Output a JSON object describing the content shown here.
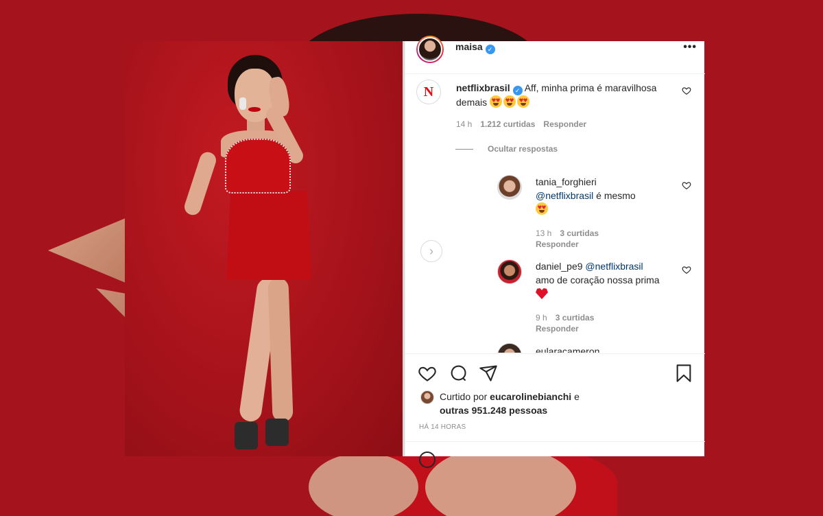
{
  "post": {
    "author": "maisa",
    "more_label": "•••"
  },
  "comments": [
    {
      "user": "netflixbrasil",
      "verified": true,
      "text": "Aff, minha prima é maravilhosa demais",
      "time": "14 h",
      "likes": "1.212 curtidas",
      "reply_label": "Responder"
    }
  ],
  "hide_replies": "Ocultar respostas",
  "replies": [
    {
      "user": "tania_forghieri",
      "mention": "@netflixbrasil",
      "text": "é mesmo",
      "time": "13 h",
      "likes": "3 curtidas",
      "reply_label": "Responder"
    },
    {
      "user": "daniel_pe9",
      "mention": "@netflixbrasil",
      "text": "amo de coração nossa prima",
      "time": "9 h",
      "likes": "3 curtidas",
      "reply_label": "Responder"
    },
    {
      "user": "eularacameron"
    }
  ],
  "likes_summary": {
    "prefix": "Curtido por",
    "user": "eucarolinebianchi",
    "connector": "e",
    "others": "outras 951.248 pessoas"
  },
  "timestamp": "HÁ 14 HORAS",
  "colors": {
    "background": "#a5141c",
    "verified": "#3897f0",
    "mention": "#00376b",
    "netflix": "#e50914"
  },
  "icons": [
    "heart-icon",
    "comment-icon",
    "share-icon",
    "bookmark-icon",
    "verified-icon",
    "next-arrow-icon",
    "more-icon"
  ]
}
